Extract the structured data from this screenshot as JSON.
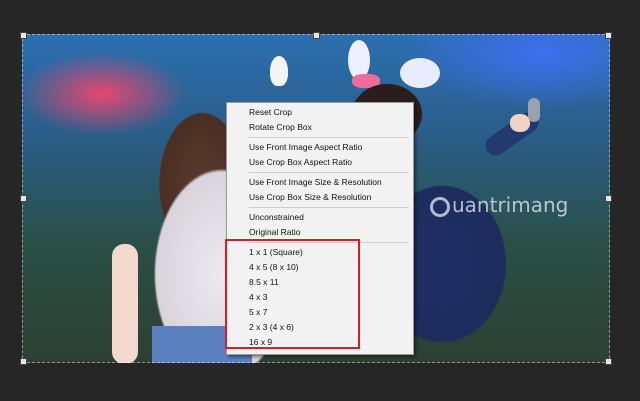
{
  "watermark": {
    "text": "uantrimang"
  },
  "context_menu": {
    "items": [
      {
        "label": "Reset Crop"
      },
      {
        "label": "Rotate Crop Box"
      },
      {
        "label": "Use Front Image Aspect Ratio"
      },
      {
        "label": "Use Crop Box Aspect Ratio"
      },
      {
        "label": "Use Front Image Size & Resolution"
      },
      {
        "label": "Use Crop Box Size & Resolution"
      },
      {
        "label": "Unconstrained"
      },
      {
        "label": "Original Ratio"
      },
      {
        "label": "1 x 1 (Square)"
      },
      {
        "label": "4 x 5 (8 x 10)"
      },
      {
        "label": "8.5 x 11"
      },
      {
        "label": "4 x 3"
      },
      {
        "label": "5 x 7"
      },
      {
        "label": "2 x 3 (4 x 6)"
      },
      {
        "label": "16 x 9"
      }
    ]
  },
  "colors": {
    "highlight": "#d31f27",
    "menu_bg": "#f2f2f2",
    "app_bg": "#262626"
  }
}
